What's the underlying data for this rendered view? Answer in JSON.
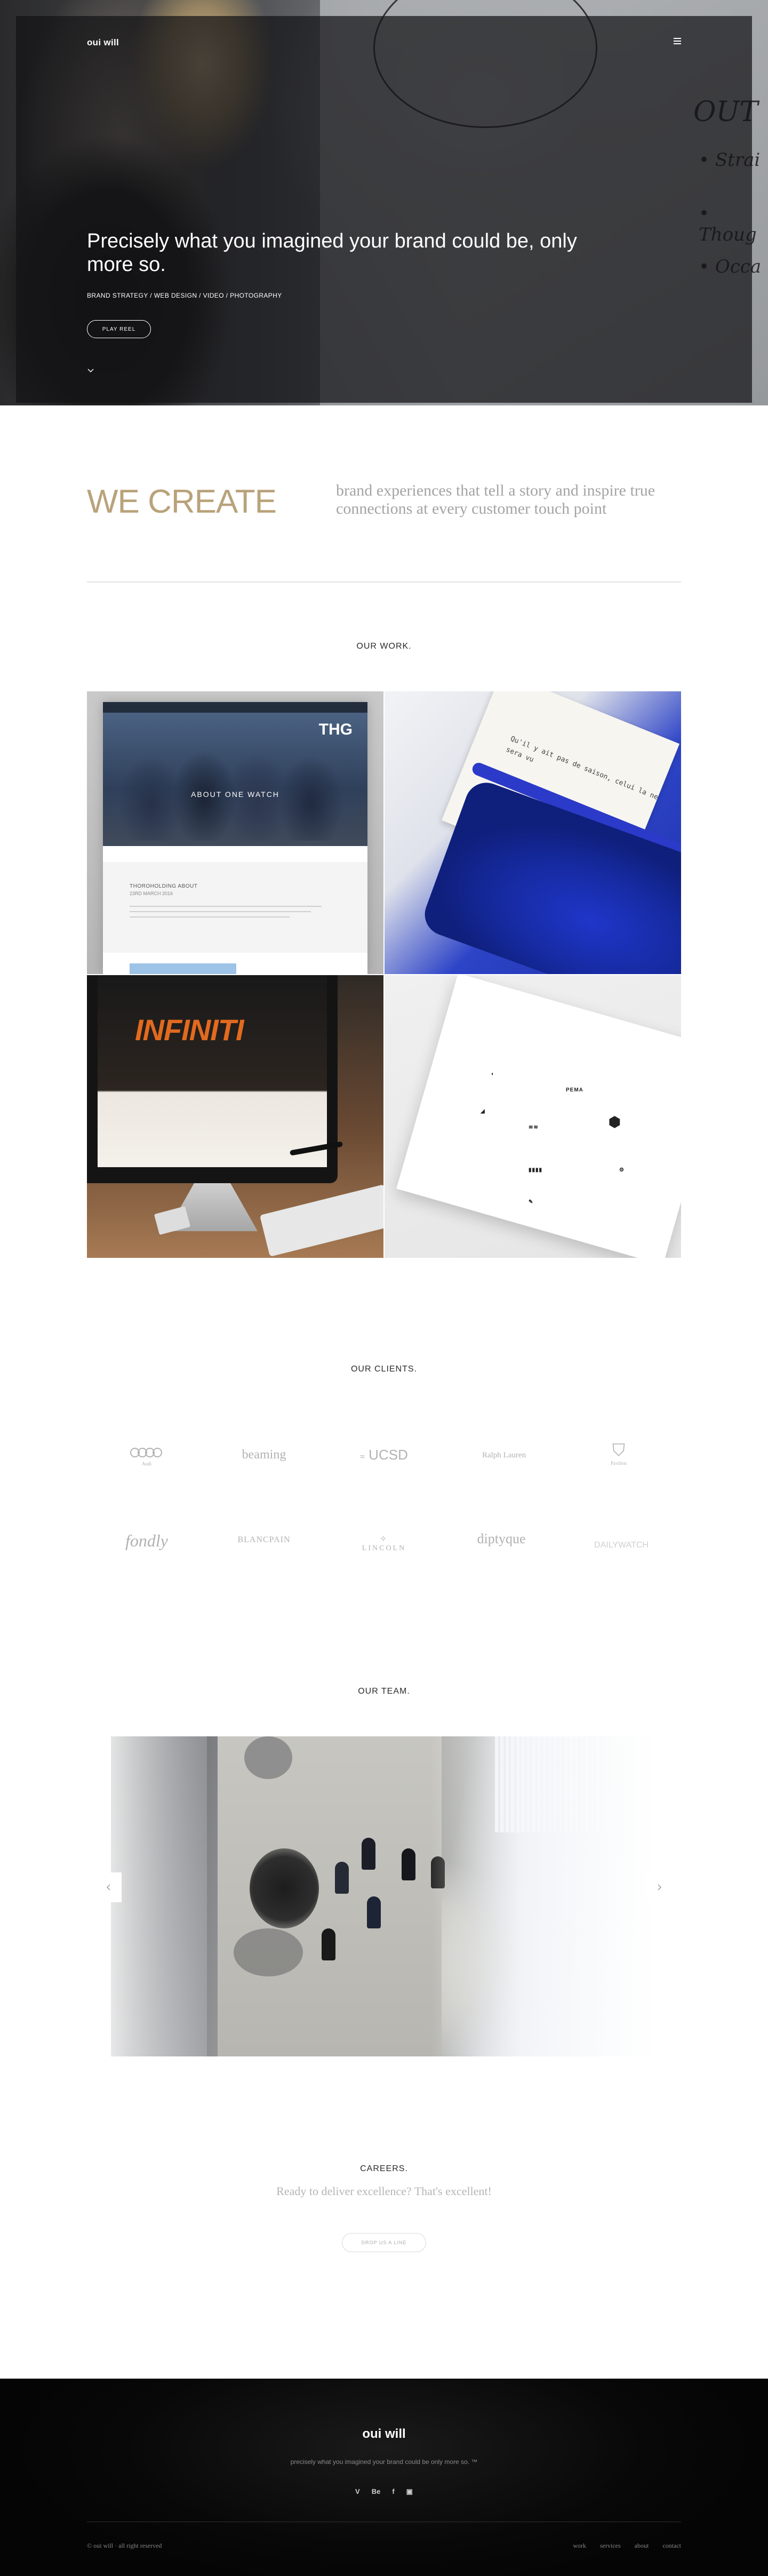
{
  "header": {
    "brand": "oui will",
    "menu_icon": "hamburger-icon"
  },
  "hero": {
    "title": "Precisely what you imagined your brand could be, only more so.",
    "subtitle": "BRAND STRATEGY / WEB DESIGN / VIDEO / PHOTOGRAPHY",
    "play_button": "PLAY REEL",
    "scroll_icon": "chevron-down-icon"
  },
  "intro": {
    "heading": "WE CREATE",
    "text": "brand experiences that tell a story and inspire true connections at every customer touch point"
  },
  "work": {
    "title": "OUR WORK.",
    "tile1": {
      "banner": "THG",
      "caption": "ABOUT ONE WATCH",
      "card_heading": "THOROHOLDING ABOUT",
      "card_date": "23RD MARCH 2016"
    },
    "tile2": {
      "typed_text": "Qu'il y ait pas de saison, celui la ne sera vu"
    },
    "tile3": {
      "logo": "INFINITI"
    }
  },
  "clients": {
    "title": "OUR CLIENTS.",
    "logos": [
      "Audi",
      "beaming",
      "UCSD",
      "Ralph Lauren",
      "Pavilion",
      "fondly",
      "BLANCPAIN",
      "LINCOLN",
      "diptyque",
      "DAILYWATCH"
    ]
  },
  "team": {
    "title": "OUR TEAM.",
    "prev_icon": "chevron-left-icon",
    "next_icon": "chevron-right-icon"
  },
  "careers": {
    "title": "CAREERS.",
    "text": "Ready to deliver excellence? That's excellent!",
    "button": "DROP US A LINE"
  },
  "footer": {
    "brand": "oui will",
    "tagline": "precisely what you imagined your brand could be only more so. ™",
    "social": [
      "V",
      "Be",
      "f",
      "▣"
    ],
    "copyright": "© oui will · all right reserved",
    "nav": [
      "work",
      "services",
      "about",
      "contact"
    ]
  },
  "colors": {
    "accent": "#b9a27a",
    "footer_bg": "#0a0a0a",
    "overlay": "#1a1a1c"
  }
}
